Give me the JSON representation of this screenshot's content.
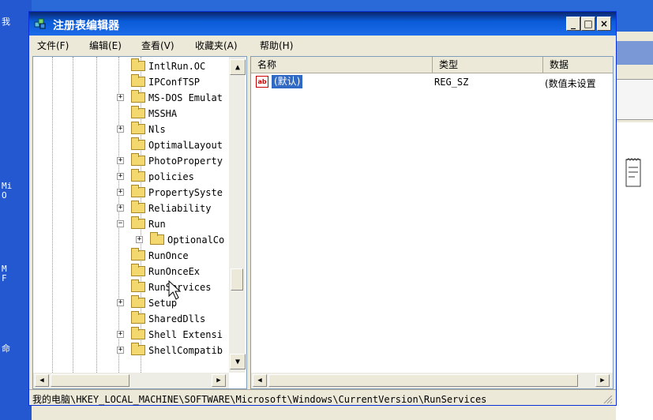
{
  "window": {
    "title": "注册表编辑器",
    "controls": {
      "minimize": "_",
      "maximize": "□",
      "close": "×"
    }
  },
  "menu": [
    {
      "label": "文件(F)"
    },
    {
      "label": "编辑(E)"
    },
    {
      "label": "查看(V)"
    },
    {
      "label": "收藏夹(A)"
    },
    {
      "label": "帮助(H)"
    }
  ],
  "tree": {
    "items": [
      {
        "label": "IntlRun.OC",
        "expander": ""
      },
      {
        "label": "IPConfTSP",
        "expander": ""
      },
      {
        "label": "MS-DOS Emulat",
        "expander": "+"
      },
      {
        "label": "MSSHA",
        "expander": ""
      },
      {
        "label": "Nls",
        "expander": "+"
      },
      {
        "label": "OptimalLayout",
        "expander": ""
      },
      {
        "label": "PhotoProperty",
        "expander": "+"
      },
      {
        "label": "policies",
        "expander": "+"
      },
      {
        "label": "PropertySyste",
        "expander": "+"
      },
      {
        "label": "Reliability",
        "expander": "+"
      },
      {
        "label": "Run",
        "expander": "−"
      },
      {
        "label": "OptionalCo",
        "expander": "+"
      },
      {
        "label": "RunOnce",
        "expander": ""
      },
      {
        "label": "RunOnceEx",
        "expander": ""
      },
      {
        "label": "RunServices",
        "expander": ""
      },
      {
        "label": "Setup",
        "expander": "+"
      },
      {
        "label": "SharedDlls",
        "expander": ""
      },
      {
        "label": "Shell Extensi",
        "expander": "+"
      },
      {
        "label": "ShellCompatib",
        "expander": "+"
      }
    ],
    "selected": "RunServices"
  },
  "list": {
    "columns": [
      "名称",
      "类型",
      "数据"
    ],
    "rows": [
      {
        "name": "(默认)",
        "type": "REG_SZ",
        "data": "(数值未设置"
      }
    ],
    "icon_text": "ab"
  },
  "statusbar": {
    "path": "我的电脑\\HKEY_LOCAL_MACHINE\\SOFTWARE\\Microsoft\\Windows\\CurrentVersion\\RunServices"
  },
  "desktop": {
    "labels": [
      "我",
      "Mi\nO",
      "M\nF",
      "命"
    ]
  },
  "colors": {
    "titlebar": "#0a5bd8",
    "selection": "#316ac5",
    "window_bg": "#ece9d8"
  }
}
